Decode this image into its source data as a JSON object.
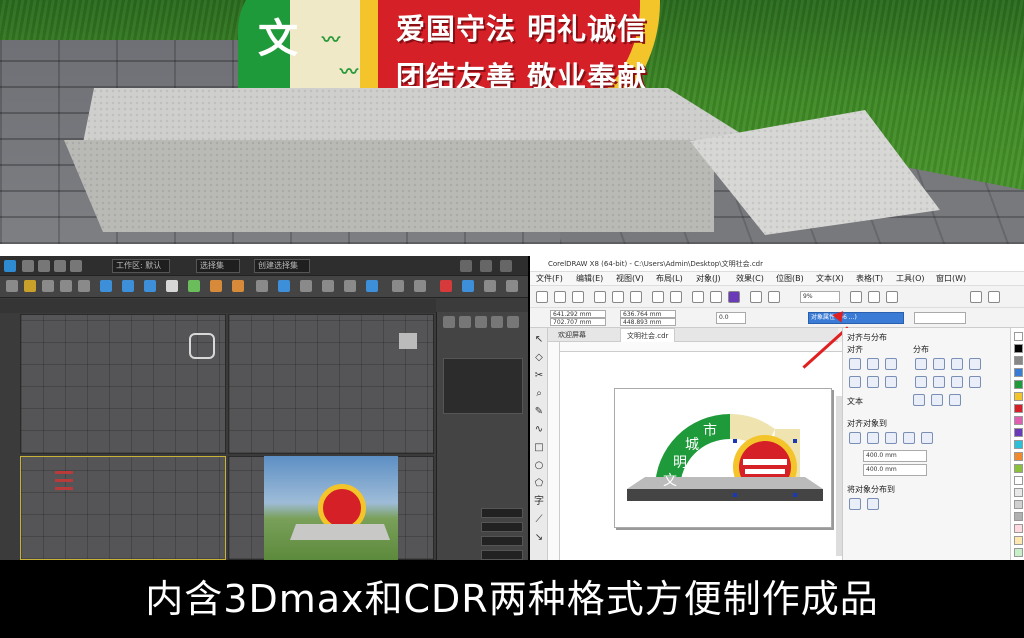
{
  "sign": {
    "char_wen": "文",
    "slogan_line1": "爱国守法 明礼诚信",
    "slogan_line2": "团结友善 敬业奉献"
  },
  "max_window": {
    "field1": "工作区: 默认",
    "field2": "选择集",
    "field3": "创建选择集"
  },
  "cdr_window": {
    "title": "CorelDRAW X8 (64-bit) - C:\\Users\\Admin\\Desktop\\文明社会.cdr",
    "menu": [
      "文件(F)",
      "编辑(E)",
      "视图(V)",
      "布局(L)",
      "对象(J)",
      "效果(C)",
      "位图(B)",
      "文本(X)",
      "表格(T)",
      "工具(O)",
      "窗口(W)"
    ],
    "tabs": [
      "欢迎屏幕",
      "文明社会.cdr"
    ],
    "percent": "9%",
    "coord_x": "641.292 mm",
    "coord_y": "702.707 mm",
    "size_w": "636.764 mm",
    "size_h": "448.893 mm",
    "angle": "0.0",
    "selected_field": "对象属性 (96 ...)",
    "docker_title": "对齐与分布",
    "docker_align": "对齐",
    "docker_distribute": "分布",
    "docker_text": "文本",
    "docker_align_to": "对齐对象到",
    "docker_val1": "400.0 mm",
    "docker_val2": "400.0 mm",
    "docker_distribute_to": "将对象分布到",
    "design_chars": [
      "市",
      "城",
      "明",
      "文"
    ]
  },
  "caption": "内含3Dmax和CDR两种格式方便制作成品",
  "colors": {
    "green": "#1f9a3a",
    "red": "#d62028",
    "yellow": "#f4c52a",
    "cream": "#efe9c8"
  }
}
